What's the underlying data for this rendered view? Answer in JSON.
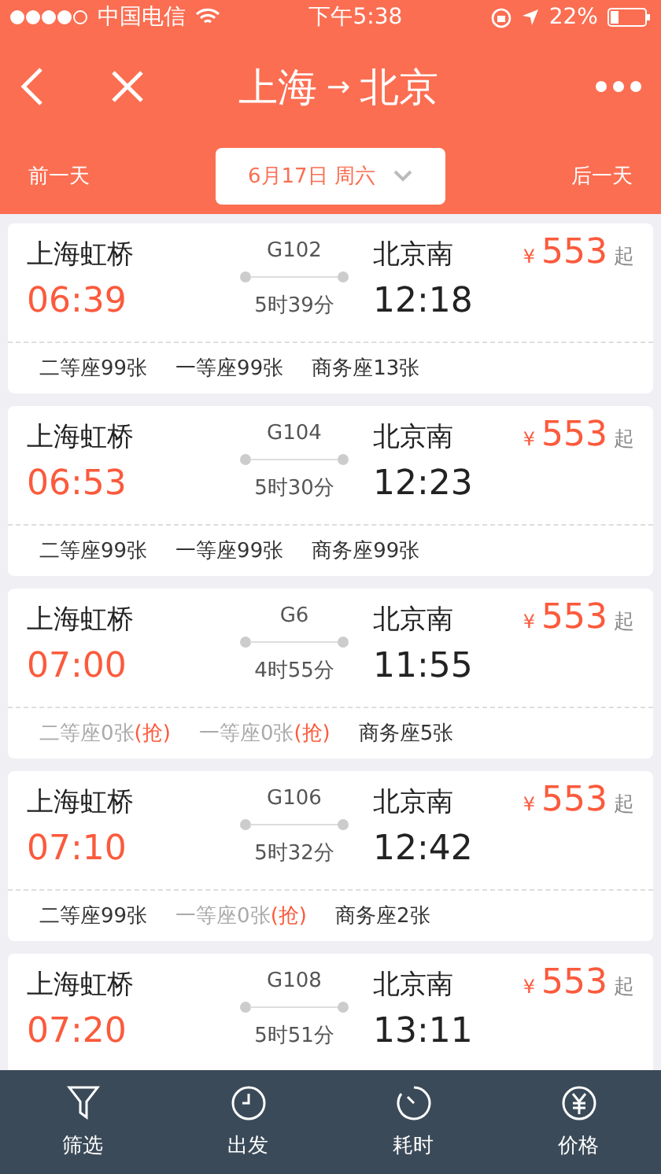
{
  "status_bar": {
    "carrier": "中国电信",
    "time": "下午5:38",
    "battery": "22%"
  },
  "nav": {
    "from": "上海",
    "arrow": "→",
    "to": "北京"
  },
  "date_bar": {
    "prev": "前一天",
    "date": "6月17日 周六",
    "next": "后一天"
  },
  "trains": [
    {
      "from_station": "上海虹桥",
      "depart": "06:39",
      "number": "G102",
      "duration": "5时39分",
      "to_station": "北京南",
      "arrive": "12:18",
      "currency": "¥",
      "price": "553",
      "price_suffix": "起",
      "seats": [
        {
          "label": "二等座99张",
          "available": true
        },
        {
          "label": "一等座99张",
          "available": true
        },
        {
          "label": "商务座13张",
          "available": true
        }
      ]
    },
    {
      "from_station": "上海虹桥",
      "depart": "06:53",
      "number": "G104",
      "duration": "5时30分",
      "to_station": "北京南",
      "arrive": "12:23",
      "currency": "¥",
      "price": "553",
      "price_suffix": "起",
      "seats": [
        {
          "label": "二等座99张",
          "available": true
        },
        {
          "label": "一等座99张",
          "available": true
        },
        {
          "label": "商务座99张",
          "available": true
        }
      ]
    },
    {
      "from_station": "上海虹桥",
      "depart": "07:00",
      "number": "G6",
      "duration": "4时55分",
      "to_station": "北京南",
      "arrive": "11:55",
      "currency": "¥",
      "price": "553",
      "price_suffix": "起",
      "seats": [
        {
          "label": "二等座0张",
          "available": false,
          "grab": "(抢)"
        },
        {
          "label": "一等座0张",
          "available": false,
          "grab": "(抢)"
        },
        {
          "label": "商务座5张",
          "available": true
        }
      ]
    },
    {
      "from_station": "上海虹桥",
      "depart": "07:10",
      "number": "G106",
      "duration": "5时32分",
      "to_station": "北京南",
      "arrive": "12:42",
      "currency": "¥",
      "price": "553",
      "price_suffix": "起",
      "seats": [
        {
          "label": "二等座99张",
          "available": true
        },
        {
          "label": "一等座0张",
          "available": false,
          "grab": "(抢)"
        },
        {
          "label": "商务座2张",
          "available": true
        }
      ]
    },
    {
      "from_station": "上海虹桥",
      "depart": "07:20",
      "number": "G108",
      "duration": "5时51分",
      "to_station": "北京南",
      "arrive": "13:11",
      "currency": "¥",
      "price": "553",
      "price_suffix": "起"
    }
  ],
  "bottom_bar": [
    {
      "kind": "filter",
      "label": "筛选"
    },
    {
      "kind": "clock",
      "label": "出发"
    },
    {
      "kind": "timer",
      "label": "耗时"
    },
    {
      "kind": "yuan",
      "label": "价格"
    }
  ]
}
